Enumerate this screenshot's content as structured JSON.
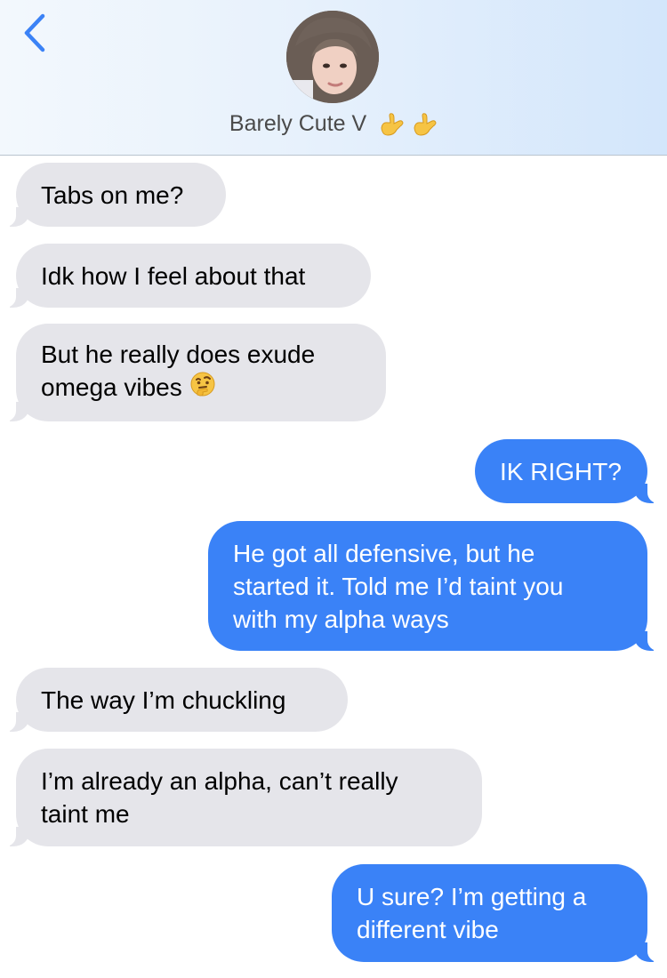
{
  "header": {
    "contact_name": "Barely Cute V",
    "name_emoji": [
      "call-me-hand-emoji",
      "call-me-hand-emoji"
    ]
  },
  "messages": [
    {
      "direction": "incoming",
      "lines": [
        "Tabs on me?"
      ]
    },
    {
      "direction": "incoming",
      "lines": [
        "Idk how I feel about that"
      ]
    },
    {
      "direction": "incoming",
      "lines": [
        "But he really does exude",
        "omega vibes"
      ],
      "emoji": "thinking-face-emoji"
    },
    {
      "direction": "outgoing",
      "lines": [
        "IK RIGHT?"
      ]
    },
    {
      "direction": "outgoing",
      "lines": [
        "He got all defensive, but he",
        "started it. Told me I’d taint you",
        "with my alpha ways"
      ]
    },
    {
      "direction": "incoming",
      "lines": [
        "The way I’m chuckling"
      ]
    },
    {
      "direction": "incoming",
      "lines": [
        "I’m already an alpha, can’t really",
        "taint me"
      ]
    },
    {
      "direction": "outgoing",
      "lines": [
        "U sure? I’m getting a",
        "different vibe"
      ]
    }
  ],
  "colors": {
    "accent": "#3a82f7",
    "incoming_bubble": "#e5e5ea",
    "back_chevron": "#3b82f6"
  }
}
